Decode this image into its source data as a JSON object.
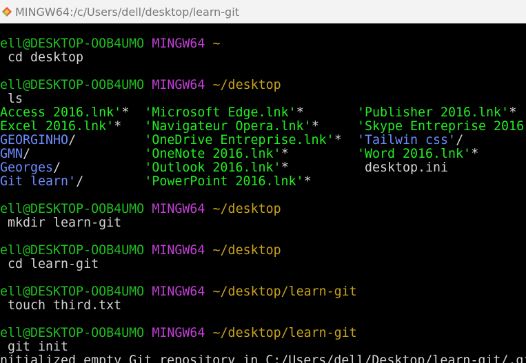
{
  "window": {
    "title": "MINGW64:/c/Users/dell/desktop/learn-git",
    "icon": "git-bash-icon"
  },
  "colors": {
    "user": "#1fbf1f",
    "system": "#c23fd6",
    "path": "#c9a21a",
    "executable": "#22ee22",
    "directory": "#6e8cff",
    "text": "#d4d4d4"
  },
  "prompt": {
    "user": "ell@DESKTOP-OOB4UMO",
    "system": "MINGW64"
  },
  "blocks": [
    {
      "path": "~",
      "command": " cd desktop"
    },
    {
      "path": "~/desktop",
      "command": " ls"
    },
    {
      "path": "~/desktop",
      "command": " mkdir learn-git"
    },
    {
      "path": "~/desktop",
      "command": " cd learn-git"
    },
    {
      "path": "~/desktop/learn-git",
      "command": " touch third.txt"
    },
    {
      "path": "~/desktop/learn-git",
      "command": " git init"
    }
  ],
  "ls_output": [
    [
      {
        "text": "Access 2016.lnk'",
        "suffix": "*",
        "kind": "exe"
      },
      {
        "text": "'Microsoft Edge.lnk'",
        "suffix": "*",
        "kind": "exe"
      },
      {
        "text": "'Publisher 2016.lnk'",
        "suffix": "*",
        "kind": "exe"
      }
    ],
    [
      {
        "text": "Excel 2016.lnk'",
        "suffix": "*",
        "kind": "exe"
      },
      {
        "text": "'Navigateur Opera.lnk'",
        "suffix": "*",
        "kind": "exe"
      },
      {
        "text": "'Skype Entreprise 2016",
        "suffix": "",
        "kind": "exe"
      }
    ],
    [
      {
        "text": "GEORGINHO",
        "suffix": "/",
        "kind": "dir"
      },
      {
        "text": "'OneDrive Entreprise.lnk'",
        "suffix": "*",
        "kind": "exe"
      },
      {
        "text": "'Tailwin css'",
        "suffix": "/",
        "kind": "dir"
      }
    ],
    [
      {
        "text": "GMN",
        "suffix": "/",
        "kind": "dir"
      },
      {
        "text": "'OneNote 2016.lnk'",
        "suffix": "*",
        "kind": "exe"
      },
      {
        "text": "'Word 2016.lnk'",
        "suffix": "*",
        "kind": "exe"
      }
    ],
    [
      {
        "text": "Georges",
        "suffix": "/",
        "kind": "dir"
      },
      {
        "text": "'Outlook 2016.lnk'",
        "suffix": "*",
        "kind": "exe"
      },
      {
        "text": " desktop.ini",
        "suffix": "",
        "kind": "plain"
      }
    ],
    [
      {
        "text": "Git learn'",
        "suffix": "/",
        "kind": "dir"
      },
      {
        "text": "'PowerPoint 2016.lnk'",
        "suffix": "*",
        "kind": "exe"
      }
    ]
  ],
  "final_output": "nitialized empty Git repository in C:/Users/dell/Desktop/learn-git/.git/"
}
